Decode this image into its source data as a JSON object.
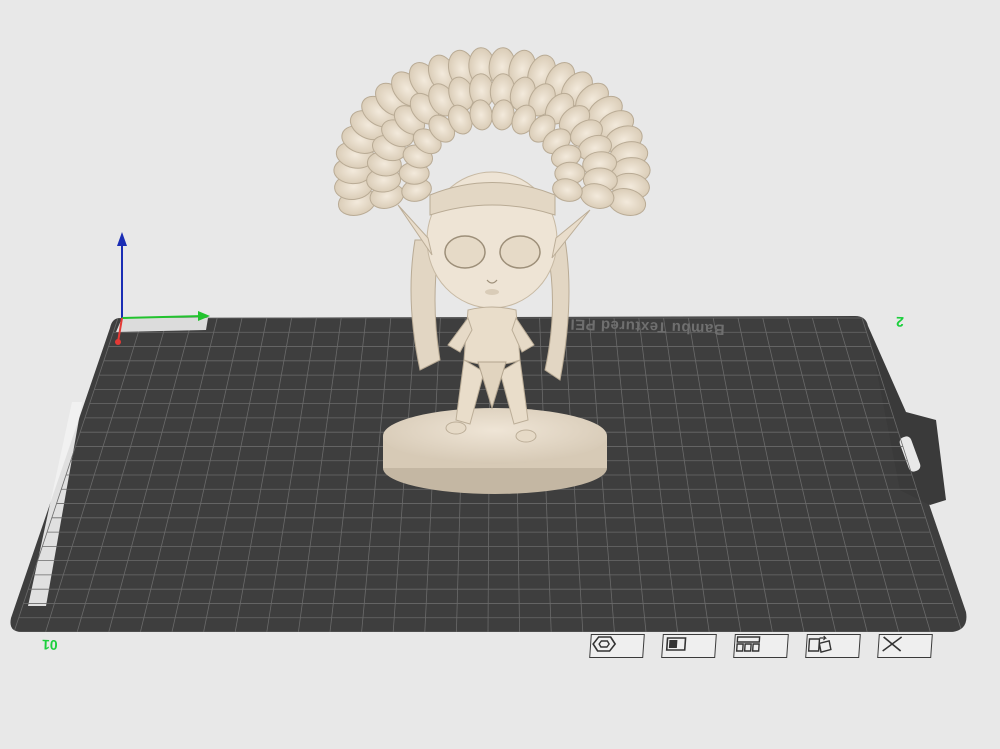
{
  "viewport": {
    "plate_name": "Bambu Textured PEI",
    "plate_number_left": "01",
    "plate_number_right": "2",
    "background_color": "#e8e8e8",
    "plate_color": "#3e3e3e",
    "grid_color": "#6a6a6a",
    "model_color": "#e7dccb"
  },
  "axes": {
    "x_color": "#e53935",
    "y_color": "#22c32e",
    "z_color": "#1a2db4"
  },
  "toolbar": [
    {
      "name": "orient-button",
      "icon": "hexagon-icon"
    },
    {
      "name": "lock-button",
      "icon": "lock-icon"
    },
    {
      "name": "arrange-button",
      "icon": "arrange-icon"
    },
    {
      "name": "auto-orient-button",
      "icon": "auto-orient-icon"
    },
    {
      "name": "delete-plate-button",
      "icon": "close-icon"
    }
  ]
}
